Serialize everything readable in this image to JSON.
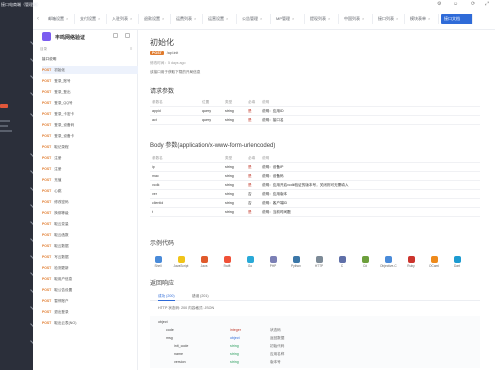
{
  "sidebar": {
    "brand": "接口电商端（管理端）"
  },
  "tabs": [
    {
      "label": "邮箱设置"
    },
    {
      "label": "支付设置"
    },
    {
      "label": "入驻列表"
    },
    {
      "label": "退款设置"
    },
    {
      "label": "运费列表"
    },
    {
      "label": "运营设置"
    },
    {
      "label": "公告管理"
    },
    {
      "label": "MP管理"
    },
    {
      "label": "提现列表"
    },
    {
      "label": "中国列表"
    },
    {
      "label": "接口列表"
    },
    {
      "label": "模块表单"
    },
    {
      "label": "接口文档",
      "active": true
    }
  ],
  "project": {
    "name": "丰鸣网络验证",
    "tree_label": "目录",
    "apis": [
      {
        "method": "",
        "name": "接口说明",
        "root": true
      },
      {
        "method": "POST",
        "name": "初始化",
        "selected": true
      },
      {
        "method": "POST",
        "name": "登录_账号"
      },
      {
        "method": "POST",
        "name": "登录_登出"
      },
      {
        "method": "POST",
        "name": "登录_QQ号"
      },
      {
        "method": "POST",
        "name": "登录_卡密卡"
      },
      {
        "method": "POST",
        "name": "登录_设备码"
      },
      {
        "method": "POST",
        "name": "登录_设备卡"
      },
      {
        "method": "POST",
        "name": "取记录程"
      },
      {
        "method": "POST",
        "name": "注册"
      },
      {
        "method": "POST",
        "name": "注册"
      },
      {
        "method": "POST",
        "name": "充值"
      },
      {
        "method": "POST",
        "name": "心跳"
      },
      {
        "method": "POST",
        "name": "修改密码"
      },
      {
        "method": "POST",
        "name": "换绑等级"
      },
      {
        "method": "POST",
        "name": "取云变量"
      },
      {
        "method": "POST",
        "name": "取云函数"
      },
      {
        "method": "POST",
        "name": "取云数据"
      },
      {
        "method": "POST",
        "name": "写云数据"
      },
      {
        "method": "POST",
        "name": "检测更新"
      },
      {
        "method": "POST",
        "name": "取用户信息"
      },
      {
        "method": "POST",
        "name": "取公告设置"
      },
      {
        "method": "POST",
        "name": "暂停账户"
      },
      {
        "method": "POST",
        "name": "退出登录"
      },
      {
        "method": "POST",
        "name": "取出云表(NO)"
      }
    ]
  },
  "main": {
    "title": "初始化",
    "method": "POST",
    "path": "/api.init",
    "time": "修改时间：5 days ago",
    "desc": "该接口用于获取下载的开局信息",
    "request_title": "请求参数",
    "request_headers": [
      "参数名",
      "位置",
      "类型",
      "必填",
      "说明"
    ],
    "request_rows": [
      {
        "name": "appid",
        "pos": "query",
        "type": "string",
        "req": "是",
        "desc": "说明：应用ID"
      },
      {
        "name": "act",
        "pos": "query",
        "type": "string",
        "req": "是",
        "desc": "说明：接口名"
      }
    ],
    "body_title": "Body 参数(application/x-www-form-urlencoded)",
    "body_headers": [
      "参数名",
      "类型",
      "必填",
      "说明"
    ],
    "body_rows": [
      {
        "name": "ip",
        "type": "string",
        "req": "是",
        "desc": "说明：设备IP"
      },
      {
        "name": "mac",
        "type": "string",
        "req": "是",
        "desc": "说明：设备码"
      },
      {
        "name": "vcdk",
        "type": "string",
        "req": "是",
        "desc": "说明：应用开启vcdk验证的版本号，关闭则可无需填入"
      },
      {
        "name": "ver",
        "type": "string",
        "req": "否",
        "desc": "说明：应用版本"
      },
      {
        "name": "clientid",
        "type": "string",
        "req": "否",
        "desc": "说明：客户端ID"
      },
      {
        "name": "t",
        "type": "string",
        "req": "是",
        "desc": "说明：当前时间戳"
      }
    ],
    "code_title": "示例代码",
    "code_langs": [
      {
        "label": "Shell",
        "color": "#4a8bd9"
      },
      {
        "label": "JavaScript",
        "color": "#f0c419"
      },
      {
        "label": "Java",
        "color": "#e05a2b"
      },
      {
        "label": "Swift",
        "color": "#f05138"
      },
      {
        "label": "Go",
        "color": "#29a9d7"
      },
      {
        "label": "PHP",
        "color": "#7b7fb5"
      },
      {
        "label": "Python",
        "color": "#3b77a8"
      },
      {
        "label": "HTTP",
        "color": "#7c8a97"
      },
      {
        "label": "C",
        "color": "#5f6fa8"
      },
      {
        "label": "C#",
        "color": "#6c9f3c"
      },
      {
        "label": "Objective-C",
        "color": "#4a8bd9"
      },
      {
        "label": "Ruby",
        "color": "#cc342d"
      },
      {
        "label": "OCaml",
        "color": "#ee8a1b"
      },
      {
        "label": "Dart",
        "color": "#1d9bd1"
      }
    ],
    "response_title": "返回响应",
    "response_tabs": [
      {
        "label": "成功 (200)",
        "active": true
      },
      {
        "label": "错误 (201)"
      }
    ],
    "response_meta": "HTTP 状态码: 200    内容格式: JSON",
    "response_rows": [
      {
        "key": "object",
        "type": "",
        "desc": "",
        "indent": 0
      },
      {
        "key": "code",
        "type": "integer",
        "desc": "状态码",
        "indent": 1,
        "cls": "t-int"
      },
      {
        "key": "msg",
        "type": "object",
        "desc": "返回数据",
        "indent": 1,
        "cls": "t-obj"
      },
      {
        "key": "init_code",
        "type": "string",
        "desc": "初始代码",
        "indent": 2,
        "cls": "t-str"
      },
      {
        "key": "name",
        "type": "string",
        "desc": "应用名称",
        "indent": 2,
        "cls": "t-str"
      },
      {
        "key": "version",
        "type": "string",
        "desc": "版本号",
        "indent": 2,
        "cls": "t-str"
      }
    ]
  }
}
